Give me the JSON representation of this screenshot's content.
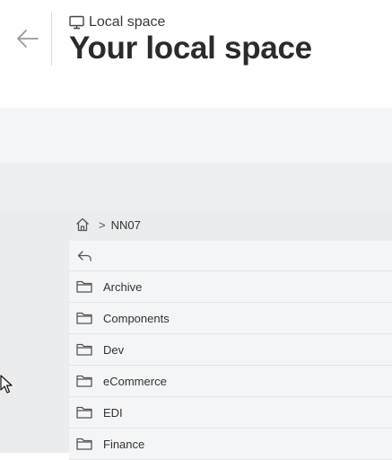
{
  "header": {
    "breadcrumb_label": "Local space",
    "title": "Your local space",
    "back_icon": "arrow-left-icon",
    "space_icon": "monitor-icon"
  },
  "path": {
    "home_icon": "home-icon",
    "separator": ">",
    "segments": [
      "NN07"
    ]
  },
  "list": {
    "up_icon": "return-arrow-icon",
    "folder_icon": "folder-icon",
    "items": [
      {
        "label": "Archive"
      },
      {
        "label": "Components"
      },
      {
        "label": "Dev"
      },
      {
        "label": "eCommerce"
      },
      {
        "label": "EDI"
      },
      {
        "label": "Finance"
      }
    ]
  }
}
